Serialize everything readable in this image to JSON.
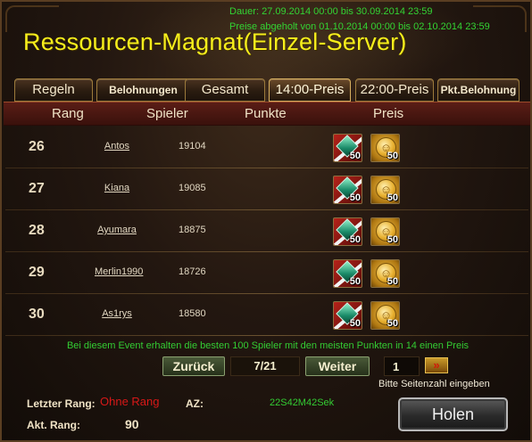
{
  "event": {
    "duration": "Dauer: 27.09.2014 00:00 bis 30.09.2014 23:59",
    "claim_period": "Preise abgeholt von 01.10.2014 00:00 bis 02.10.2014 23:59",
    "title": "Ressourcen-Magnat(Einzel-Server)"
  },
  "tabs": [
    {
      "label": "Regeln"
    },
    {
      "label": "Belohnungen"
    },
    {
      "label": "Gesamt"
    },
    {
      "label": "14:00-Preis"
    },
    {
      "label": "22:00-Preis"
    },
    {
      "label": "Pkt.Belohnung"
    }
  ],
  "table": {
    "headers": {
      "rank": "Rang",
      "player": "Spieler",
      "points": "Punkte",
      "prize": "Preis"
    },
    "rows": [
      {
        "rank": "26",
        "player": "Antos",
        "points": "19104",
        "prize_qty": [
          "50",
          "50"
        ]
      },
      {
        "rank": "27",
        "player": "Kiana",
        "points": "19085",
        "prize_qty": [
          "50",
          "50"
        ]
      },
      {
        "rank": "28",
        "player": "Ayumara",
        "points": "18875",
        "prize_qty": [
          "50",
          "50"
        ]
      },
      {
        "rank": "29",
        "player": "Merlin1990",
        "points": "18726",
        "prize_qty": [
          "50",
          "50"
        ]
      },
      {
        "rank": "30",
        "player": "As1rys",
        "points": "18580",
        "prize_qty": [
          "50",
          "50"
        ]
      }
    ],
    "prize_icons": [
      "gem-crate-icon",
      "gold-coin-icon"
    ]
  },
  "info": "Bei diesem Event erhalten die besten 100 Spieler mit den meisten Punkten in 14 einen Preis",
  "pager": {
    "prev_label": "Zurück",
    "page_display": "7/21",
    "next_label": "Weiter",
    "page_input_value": "1",
    "go_label": "»",
    "hint": "Bitte Seitenzahl eingeben"
  },
  "footer": {
    "last_rank_label": "Letzter Rang:",
    "last_rank_value": "Ohne Rang",
    "current_rank_label": "Akt. Rang:",
    "current_rank_value": "90",
    "az_label": "AZ:",
    "az_value": "22S42M42Sek",
    "claim_button": "Holen"
  },
  "colors": {
    "title": "#f6ee1c",
    "date_text": "#33d433",
    "info_text": "#33cc33",
    "red_text": "#d81818"
  }
}
